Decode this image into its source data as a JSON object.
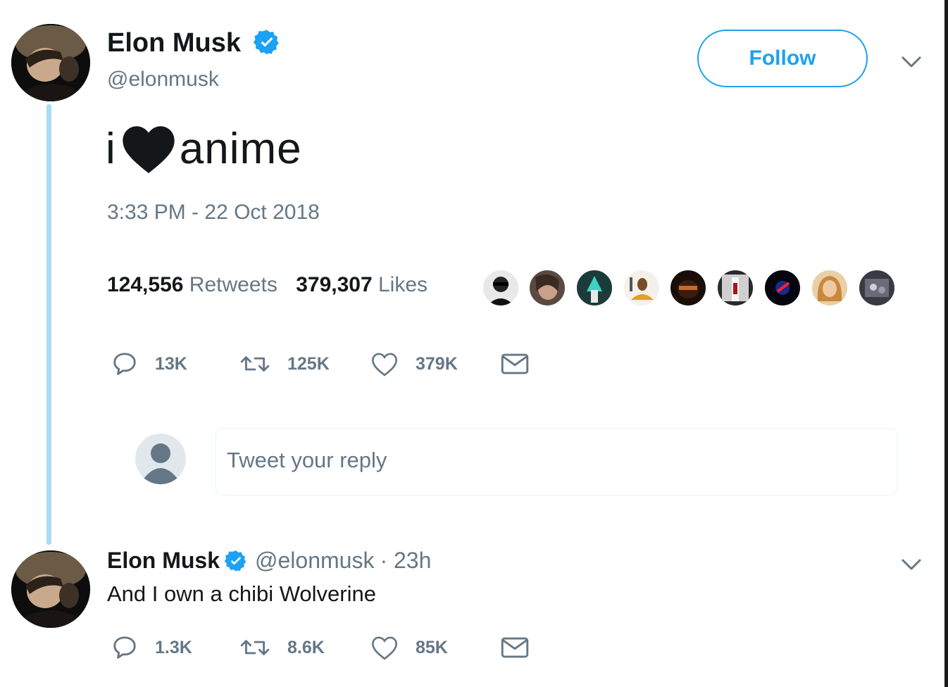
{
  "tweet": {
    "author_name": "Elon Musk",
    "handle": "@elonmusk",
    "follow_label": "Follow",
    "text_before": "i",
    "text_after": "anime",
    "timestamp": "3:33 PM - 22 Oct 2018",
    "retweets_count": "124,556",
    "retweets_label": "Retweets",
    "likes_count": "379,307",
    "likes_label": "Likes",
    "actions": {
      "replies": "13K",
      "retweets": "125K",
      "likes": "379K"
    }
  },
  "reply_input": {
    "placeholder": "Tweet your reply"
  },
  "reply": {
    "author_name": "Elon Musk",
    "handle": "@elonmusk",
    "time": "· 23h",
    "text": "And I own a chibi Wolverine",
    "actions": {
      "replies": "1.3K",
      "retweets": "8.6K",
      "likes": "85K"
    }
  },
  "colors": {
    "accent": "#1da1f2",
    "thread_line": "#a7dcf5",
    "muted_text": "#657786"
  }
}
